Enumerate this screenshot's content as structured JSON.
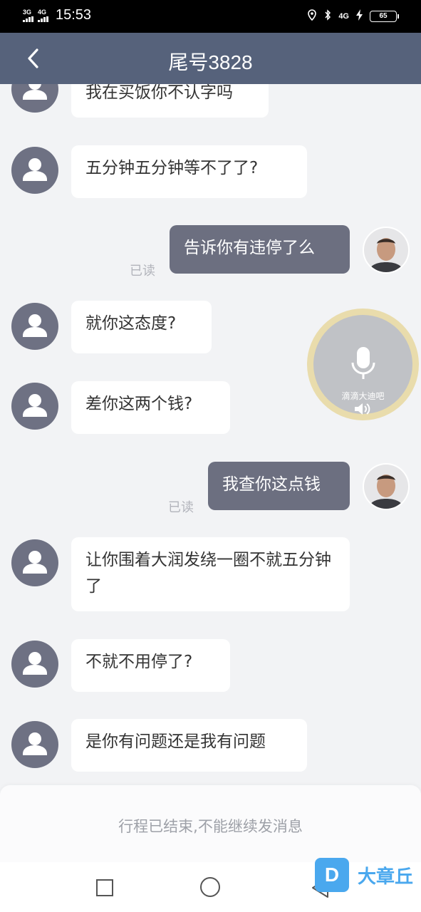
{
  "status_bar": {
    "network1": "3G",
    "network2": "4G",
    "time": "15:53",
    "network3": "4G",
    "battery": "65"
  },
  "header": {
    "title": "尾号3828"
  },
  "messages": [
    {
      "from": "driver",
      "text": "我在买饭你不认字吗"
    },
    {
      "from": "driver",
      "text": "五分钟五分钟等不了了?"
    },
    {
      "from": "me",
      "text": "告诉你有违停了么",
      "status": "已读"
    },
    {
      "from": "driver",
      "text": "就你这态度?"
    },
    {
      "from": "driver",
      "text": "差你这两个钱?"
    },
    {
      "from": "me",
      "text": "我查你这点钱",
      "status": "已读"
    },
    {
      "from": "driver",
      "text": "让你围着大润发绕一圈不就五分钟了"
    },
    {
      "from": "driver",
      "text": "不就不用停了?"
    },
    {
      "from": "driver",
      "text": "是你有问题还是我有问题"
    }
  ],
  "voice_widget": {
    "label": "滴滴大迪吧"
  },
  "footer": {
    "ended_text": "行程已结束,不能继续发消息"
  },
  "watermark": {
    "logo": "D",
    "text": "大章丘"
  }
}
